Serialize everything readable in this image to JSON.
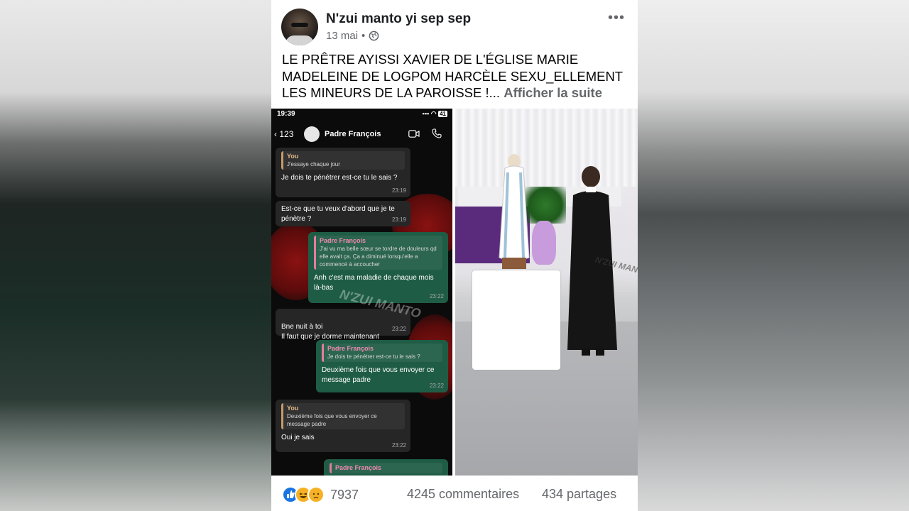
{
  "post": {
    "author": "N'zui manto yi sep sep",
    "date": "13 mai",
    "separator": "•",
    "privacy_icon": "globe-icon",
    "more_icon": "more-horizontal-icon",
    "text": "LE PRÊTRE AYISSI XAVIER DE L'ÉGLISE MARIE MADELEINE DE LOGPOM HARCÈLE SEXU_ELLEMENT LES MINEURS DE LA PAROISSE !...",
    "see_more": "Afficher la suite"
  },
  "chat_screenshot": {
    "status_time": "19:39",
    "battery": "41",
    "back_count": "123",
    "contact": "Padre François",
    "messages": [
      {
        "dir": "in",
        "quote_name": "You",
        "quote_text": "J'essaye chaque jour",
        "text": "Je dois te pénétrer est-ce tu le sais ?",
        "time": "23:19"
      },
      {
        "dir": "in",
        "text": "Est-ce que tu veux d'abord que je te pénètre ?",
        "time": "23:19"
      },
      {
        "dir": "out",
        "quote_name": "Padre François",
        "quote_text": "J'ai vu ma belle sœur se tordre de douleurs qd elle avait ça. Ça a diminué lorsqu'elle a commencé à accoucher",
        "text": "Anh c'est ma maladie de chaque mois là-bas",
        "time": "23:22"
      },
      {
        "dir": "in",
        "text": "Bne nuit à toi\nIl faut que je dorme maintenant",
        "time": "23:22"
      },
      {
        "dir": "out",
        "quote_name": "Padre François",
        "quote_text": "Je dois te pénétrer est-ce tu le sais ?",
        "text": "Deuxième fois que vous envoyer ce message padre",
        "time": "23:22"
      },
      {
        "dir": "in",
        "quote_name": "You",
        "quote_text": "Deuxième fois que vous envoyer ce message padre",
        "text": "Oui je sais",
        "time": "23:22"
      },
      {
        "dir": "out",
        "quote_name": "Padre François",
        "quote_text": "",
        "text": "",
        "time": ""
      }
    ],
    "watermark": "N'ZUI MANTO"
  },
  "photo": {
    "watermark": "N'ZUI MANTO"
  },
  "footer": {
    "reaction_icons": [
      "like-icon",
      "haha-icon",
      "sad-icon"
    ],
    "reaction_count": "7937",
    "comments": "4245 commentaires",
    "shares": "434 partages"
  },
  "colors": {
    "brand_blue": "#1b74e4",
    "text_secondary": "#65676b",
    "chat_out": "#1f5c46",
    "chat_in": "#262626"
  }
}
